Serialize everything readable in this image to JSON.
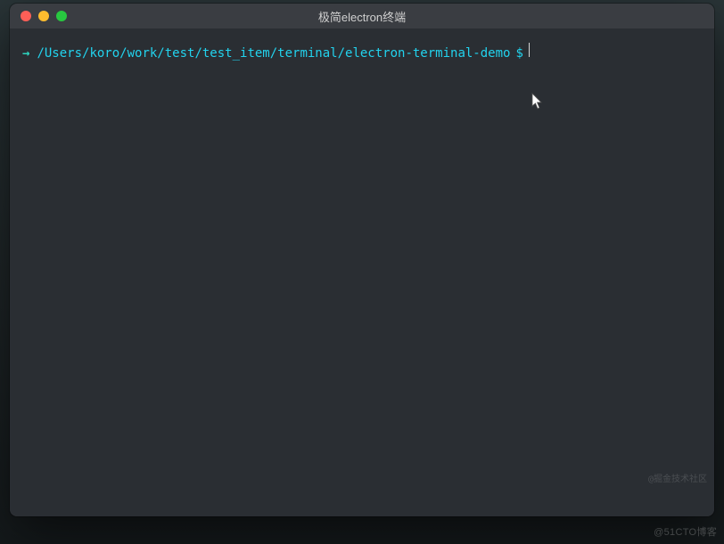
{
  "window": {
    "title": "极简electron终端"
  },
  "terminal": {
    "arrow": "→",
    "cwd": "/Users/koro/work/test/test_item/terminal/electron-terminal-demo",
    "prompt_symbol": "$",
    "input": ""
  },
  "colors": {
    "bg": "#2a2e33",
    "titlebar": "#3a3d42",
    "accent_path": "#22d3ee",
    "accent_arrow": "#2dd4bf"
  },
  "watermark": {
    "bottom": "@51CTO博客",
    "inner": "@掘金技术社区"
  }
}
